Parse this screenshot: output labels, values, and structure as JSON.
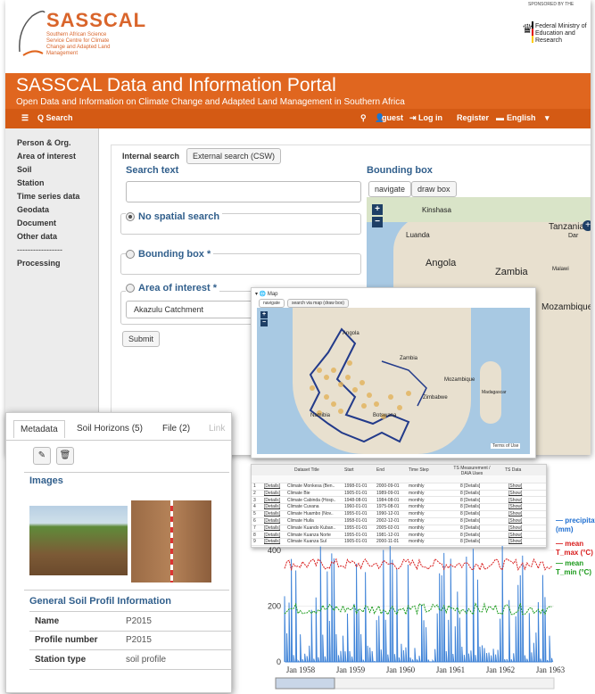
{
  "header": {
    "logo_text": "SASSCAL",
    "logo_sub": "Southern African Science Service Centre for Climate Change and Adapted Land Management",
    "sponsor_small": "SPONSORED BY THE",
    "sponsor_text": "Federal Ministry of Education and Research",
    "title": "SASSCAL Data and Information Portal",
    "subtitle": "Open Data and Information on Climate Change and Adapted Land Management in Southern Africa"
  },
  "nav": {
    "search": "Q Search",
    "guest": "guest",
    "login": "Log in",
    "register": "Register",
    "language": "English"
  },
  "sidebar": [
    "Person & Org.",
    "Area of interest",
    "Soil",
    "Station",
    "Time series data",
    "Geodata",
    "Document",
    "Other data",
    "-----------------",
    "Processing"
  ],
  "search": {
    "tab_internal": "Internal search",
    "tab_external": "External search (CSW)",
    "search_text_label": "Search text",
    "no_spatial": "No spatial search",
    "bbox_label": "Bounding box *",
    "aoi_label": "Area of interest *",
    "aoi_value": "Akazulu Catchment",
    "submit": "Submit",
    "bbox_title": "Bounding box",
    "navigate": "navigate",
    "draw_box": "draw box"
  },
  "map1": {
    "labels": [
      "Kinshasa",
      "Luanda",
      "Angola",
      "Zambia",
      "Malawi",
      "Tanzania",
      "Dar",
      "Mozambique"
    ]
  },
  "map2": {
    "title": "Map",
    "navigate": "navigate",
    "search_via_map": "search via map (draw box)",
    "labels": [
      "Angola",
      "Zambia",
      "Zimbabwe",
      "Mozambique",
      "Botswana",
      "Namibia",
      "Madagascar"
    ],
    "attribution": "Terms of Use"
  },
  "table": {
    "headers": [
      "Dataset Title",
      "Start",
      "End",
      "Time Step",
      "TS Measurement / DAIA Uaes",
      "TS Data"
    ],
    "rows": [
      [
        "1",
        "[Details]",
        "Climate Monkesa (Ben..",
        "1998-01-01",
        "2000-09-01",
        "monthly",
        "8 [Details]",
        "[Show]"
      ],
      [
        "2",
        "[Details]",
        "Climate Bie",
        "1905-01-01",
        "1989-09-01",
        "monthly",
        "8 [Details]",
        "[Show]"
      ],
      [
        "3",
        "[Details]",
        "Climate Cabinda (Hosp..",
        "1948-08-01",
        "1984-08-01",
        "monthly",
        "8 [Details]",
        "[Show]"
      ],
      [
        "4",
        "[Details]",
        "Climate Cuvana",
        "1960-01-01",
        "1975-08-01",
        "monthly",
        "8 [Details]",
        "[Show]"
      ],
      [
        "5",
        "[Details]",
        "Climate Huambo (Nov..",
        "1955-01-01",
        "1990-12-01",
        "monthly",
        "8 [Details]",
        "[Show]"
      ],
      [
        "6",
        "[Details]",
        "Climate Huila",
        "1958-01-01",
        "2002-12-01",
        "monthly",
        "8 [Details]",
        "[Show]"
      ],
      [
        "7",
        "[Details]",
        "Climate Kuando Kuban..",
        "1955-01-01",
        "2005-02-01",
        "monthly",
        "8 [Details]",
        "[Show]"
      ],
      [
        "8",
        "[Details]",
        "Climate Kuanza Norte",
        "1955-01-01",
        "1981-12-01",
        "monthly",
        "8 [Details]",
        "[Show]"
      ],
      [
        "9",
        "[Details]",
        "Climate Kuanza Sul",
        "1905-01-01",
        "2000-11-01",
        "monthly",
        "8 [Details]",
        "[Show]"
      ]
    ]
  },
  "metadata": {
    "tabs": [
      "Metadata",
      "Soil Horizons (5)",
      "File (2)",
      "Link"
    ],
    "images_title": "Images",
    "general_title": "General Soil Profil Information",
    "rows": [
      {
        "k": "Name",
        "v": "P2015"
      },
      {
        "k": "Profile number",
        "v": "P2015"
      },
      {
        "k": "Station type",
        "v": "soil profile"
      }
    ]
  },
  "chart_data": {
    "type": "line",
    "x_ticks": [
      "Jan 1958",
      "Jan 1959",
      "Jan 1960",
      "Jan 1961",
      "Jan 1962",
      "Jan 1963"
    ],
    "y_ticks": [
      0,
      200,
      400
    ],
    "ylim": [
      0,
      480
    ],
    "legend": [
      {
        "name": "precipitation (mm)",
        "color": "#1f6fd1"
      },
      {
        "name": "mean T_max (°C)",
        "color": "#d81b1b"
      },
      {
        "name": "mean T_min (°C)",
        "color": "#1a9a1a"
      }
    ],
    "series_levels": {
      "precipitation": "spikes 0-420",
      "tmax": "~350",
      "tmin": "~200"
    }
  },
  "colors": {
    "brand": "#e0661f",
    "nav": "#d45a14",
    "heading": "#315f8c"
  }
}
